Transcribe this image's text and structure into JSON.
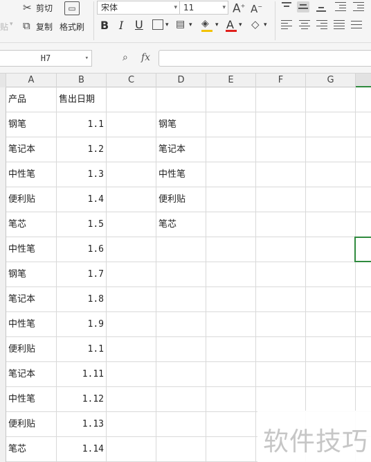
{
  "ribbon": {
    "cut_label": "剪切",
    "copy_label": "复制",
    "paste_label": "贴",
    "format_painter_label": "格式刷",
    "font_name": "宋体",
    "font_size": "11",
    "bold": "B",
    "italic": "I",
    "underline": "U",
    "font_color_letter": "A",
    "accent_font_color": "#e0201b",
    "accent_fill_color": "#f2c200"
  },
  "formula_bar": {
    "name_box": "H7",
    "fx_label": "fx",
    "formula_value": ""
  },
  "sheet": {
    "columns": [
      "A",
      "B",
      "C",
      "D",
      "E",
      "F",
      "G"
    ],
    "rows": [
      {
        "a": "产品",
        "b": "售出日期",
        "d": ""
      },
      {
        "a": "钢笔",
        "b": "1.1",
        "d": "钢笔"
      },
      {
        "a": "笔记本",
        "b": "1.2",
        "d": "笔记本"
      },
      {
        "a": "中性笔",
        "b": "1.3",
        "d": "中性笔"
      },
      {
        "a": "便利贴",
        "b": "1.4",
        "d": "便利贴"
      },
      {
        "a": "笔芯",
        "b": "1.5",
        "d": "笔芯"
      },
      {
        "a": "中性笔",
        "b": "1.6",
        "d": ""
      },
      {
        "a": "钢笔",
        "b": "1.7",
        "d": ""
      },
      {
        "a": "笔记本",
        "b": "1.8",
        "d": ""
      },
      {
        "a": "中性笔",
        "b": "1.9",
        "d": ""
      },
      {
        "a": "便利贴",
        "b": "1.1",
        "d": ""
      },
      {
        "a": "笔记本",
        "b": "1.11",
        "d": ""
      },
      {
        "a": "中性笔",
        "b": "1.12",
        "d": ""
      },
      {
        "a": "便利贴",
        "b": "1.13",
        "d": ""
      },
      {
        "a": "笔芯",
        "b": "1.14",
        "d": ""
      }
    ]
  },
  "watermark": "软件技巧"
}
